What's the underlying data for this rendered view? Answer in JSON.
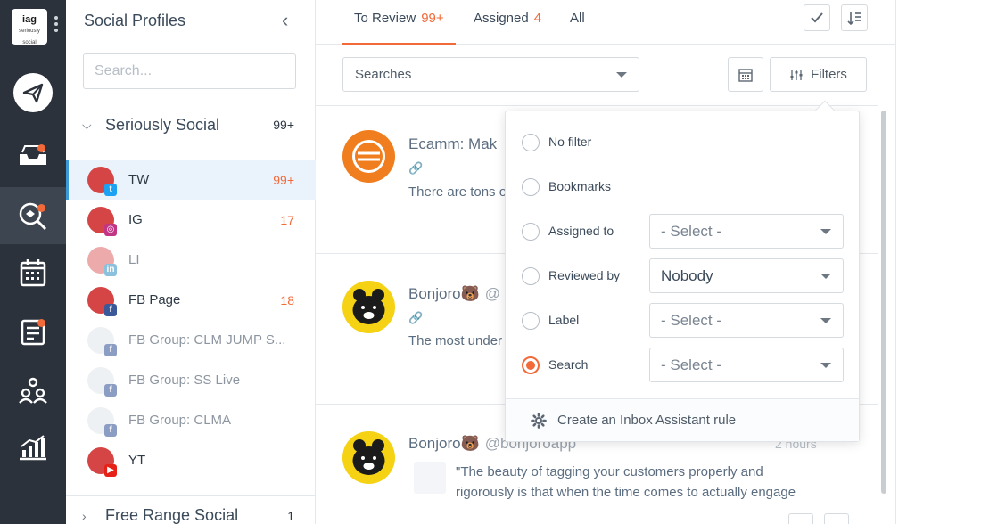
{
  "rail": {
    "brand_text": "iag",
    "brand_sub": "seriously social",
    "icons": [
      "send-icon",
      "inbox-icon",
      "listening-icon",
      "calendar-icon",
      "tasks-icon",
      "team-icon",
      "reports-icon"
    ],
    "accent": "#f26a3a"
  },
  "profiles": {
    "title": "Social Profiles",
    "search_placeholder": "Search...",
    "group1": {
      "name": "Seriously Social",
      "count": "99+"
    },
    "items": [
      {
        "label": "TW",
        "count": "99+",
        "network": "twitter"
      },
      {
        "label": "IG",
        "count": "17",
        "network": "instagram"
      },
      {
        "label": "LI",
        "count": "",
        "network": "linkedin"
      },
      {
        "label": "FB Page",
        "count": "18",
        "network": "facebook"
      },
      {
        "label": "FB Group: CLM JUMP S...",
        "count": "",
        "network": "facebook"
      },
      {
        "label": "FB Group: SS Live",
        "count": "",
        "network": "facebook"
      },
      {
        "label": "FB Group: CLMA",
        "count": "",
        "network": "facebook"
      },
      {
        "label": "YT",
        "count": "",
        "network": "youtube"
      }
    ],
    "group2": {
      "name": "Free Range Social",
      "count": "1"
    }
  },
  "tabs": [
    {
      "label": "To Review",
      "count": "99+"
    },
    {
      "label": "Assigned",
      "count": "4"
    },
    {
      "label": "All",
      "count": ""
    }
  ],
  "toolbar": {
    "searches_label": "Searches",
    "filters_label": "Filters"
  },
  "posts": [
    {
      "name": "Ecamm: Mak",
      "handle": "",
      "text": "There are tons o",
      "time": ""
    },
    {
      "name": "Bonjoro🐻",
      "handle": "@",
      "text": "The most under",
      "time": ""
    },
    {
      "name": "Bonjoro🐻",
      "handle": "@bonjoroapp",
      "text": "\"The beauty of tagging your customers properly and",
      "text2": "rigorously is that when the time comes to actually engage",
      "time": "2 hours"
    }
  ],
  "filters": {
    "options": [
      {
        "label": "No filter",
        "select": ""
      },
      {
        "label": "Bookmarks",
        "select": ""
      },
      {
        "label": "Assigned to",
        "select": "- Select -"
      },
      {
        "label": "Reviewed by",
        "select": "Nobody"
      },
      {
        "label": "Label",
        "select": "- Select -"
      },
      {
        "label": "Search",
        "select": "- Select -"
      }
    ],
    "selected": "Search",
    "footer": "Create an Inbox Assistant rule"
  }
}
